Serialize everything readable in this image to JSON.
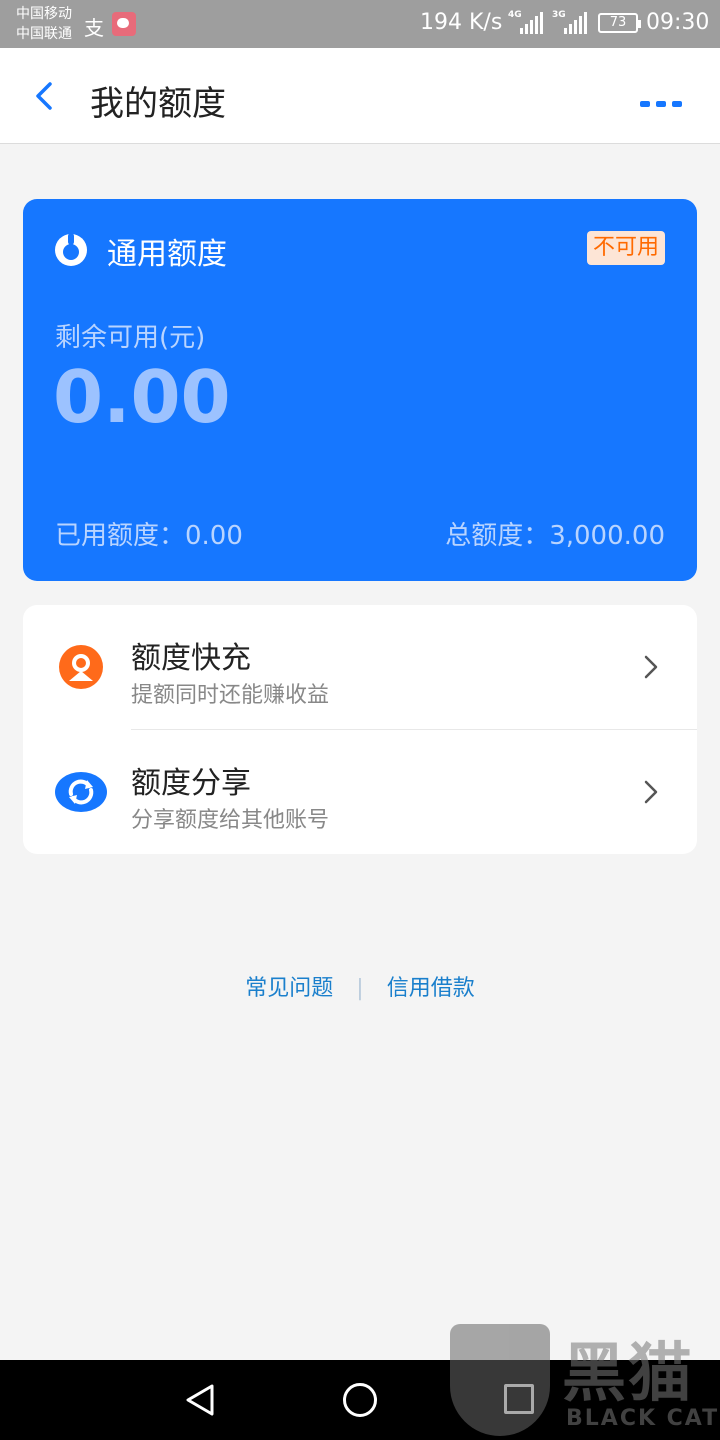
{
  "status_bar": {
    "carrier1": "中国移动",
    "carrier2": "中国联通",
    "net_speed": "194 K/s",
    "signal1_label": "4G",
    "signal2_label": "3G",
    "battery": "73",
    "time": "09:30"
  },
  "header": {
    "title": "我的额度",
    "back_icon": "chevron-left-icon",
    "more_icon": "more-icon"
  },
  "card": {
    "title": "通用额度",
    "badge": "不可用",
    "available_label": "剩余可用(元)",
    "available_amount": "0.00",
    "used_label": "已用额度：0.00",
    "total_label": "总额度：3,000.00",
    "colors": {
      "background": "#1677ff",
      "badge_text": "#ff6a00"
    }
  },
  "options": [
    {
      "title": "额度快充",
      "desc": "提额同时还能赚收益",
      "icon": "quick-charge-icon"
    },
    {
      "title": "额度分享",
      "desc": "分享额度给其他账号",
      "icon": "share-icon"
    }
  ],
  "footer": {
    "faq": "常见问题",
    "separator": "|",
    "credit_loan": "信用借款"
  },
  "watermark": {
    "cn": "黑猫",
    "en": "BLACK CAT"
  }
}
